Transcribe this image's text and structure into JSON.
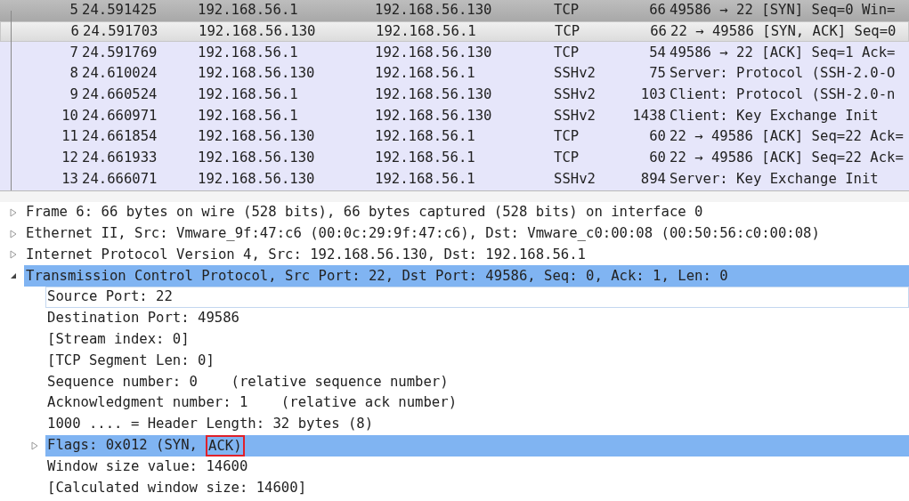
{
  "packet_list": {
    "rows": [
      {
        "no": "5",
        "time": "24.591425",
        "source": "192.168.56.1",
        "destination": "192.168.56.130",
        "protocol": "TCP",
        "length": "66",
        "info": "49586 → 22 [SYN] Seq=0 Win=",
        "selected": false,
        "hovered": true
      },
      {
        "no": "6",
        "time": "24.591703",
        "source": "192.168.56.130",
        "destination": "192.168.56.1",
        "protocol": "TCP",
        "length": "66",
        "info": "22 → 49586 [SYN, ACK] Seq=0",
        "selected": true,
        "hovered": false
      },
      {
        "no": "7",
        "time": "24.591769",
        "source": "192.168.56.1",
        "destination": "192.168.56.130",
        "protocol": "TCP",
        "length": "54",
        "info": "49586 → 22 [ACK] Seq=1 Ack=",
        "selected": false,
        "hovered": false
      },
      {
        "no": "8",
        "time": "24.610024",
        "source": "192.168.56.130",
        "destination": "192.168.56.1",
        "protocol": "SSHv2",
        "length": "75",
        "info": "Server: Protocol (SSH-2.0-O",
        "selected": false,
        "hovered": false
      },
      {
        "no": "9",
        "time": "24.660524",
        "source": "192.168.56.1",
        "destination": "192.168.56.130",
        "protocol": "SSHv2",
        "length": "103",
        "info": "Client: Protocol (SSH-2.0-n",
        "selected": false,
        "hovered": false
      },
      {
        "no": "10",
        "time": "24.660971",
        "source": "192.168.56.1",
        "destination": "192.168.56.130",
        "protocol": "SSHv2",
        "length": "1438",
        "info": "Client: Key Exchange Init",
        "selected": false,
        "hovered": false
      },
      {
        "no": "11",
        "time": "24.661854",
        "source": "192.168.56.130",
        "destination": "192.168.56.1",
        "protocol": "TCP",
        "length": "60",
        "info": "22 → 49586 [ACK] Seq=22 Ack=",
        "selected": false,
        "hovered": false
      },
      {
        "no": "12",
        "time": "24.661933",
        "source": "192.168.56.130",
        "destination": "192.168.56.1",
        "protocol": "TCP",
        "length": "60",
        "info": "22 → 49586 [ACK] Seq=22 Ack=",
        "selected": false,
        "hovered": false
      },
      {
        "no": "13",
        "time": "24.666071",
        "source": "192.168.56.130",
        "destination": "192.168.56.1",
        "protocol": "SSHv2",
        "length": "894",
        "info": "Server: Key Exchange Init",
        "selected": false,
        "hovered": false
      }
    ]
  },
  "packet_details": {
    "items": [
      {
        "text": "Frame 6: 66 bytes on wire (528 bits), 66 bytes captured (528 bits) on interface 0",
        "expanded": false,
        "selected": false
      },
      {
        "text": "Ethernet II, Src: Vmware_9f:47:c6 (00:0c:29:9f:47:c6), Dst: Vmware_c0:00:08 (00:50:56:c0:00:08)",
        "expanded": false,
        "selected": false
      },
      {
        "text": "Internet Protocol Version 4, Src: 192.168.56.130, Dst: 192.168.56.1",
        "expanded": false,
        "selected": false
      },
      {
        "text": "Transmission Control Protocol, Src Port: 22, Dst Port: 49586, Seq: 0, Ack: 1, Len: 0",
        "expanded": true,
        "selected": true,
        "children": [
          {
            "text": "Source Port: 22",
            "selected": false,
            "focused": true
          },
          {
            "text": "Destination Port: 49586",
            "selected": false,
            "focused": false
          },
          {
            "text": "[Stream index: 0]",
            "selected": false,
            "focused": false
          },
          {
            "text": "[TCP Segment Len: 0]",
            "selected": false,
            "focused": false
          },
          {
            "text": "Sequence number: 0    (relative sequence number)",
            "selected": false,
            "focused": false
          },
          {
            "text": "Acknowledgment number: 1    (relative ack number)",
            "selected": false,
            "focused": false
          },
          {
            "text": "1000 .... = Header Length: 32 bytes (8)",
            "selected": false,
            "focused": false
          },
          {
            "text": "Flags: 0x012 (SYN,",
            "boxed_text": "ACK)",
            "expanded": false,
            "selected": true,
            "focused": false
          },
          {
            "text": "Window size value: 14600",
            "selected": false,
            "focused": false
          },
          {
            "text": "[Calculated window size: 14600]",
            "selected": false,
            "focused": false
          }
        ]
      }
    ]
  }
}
